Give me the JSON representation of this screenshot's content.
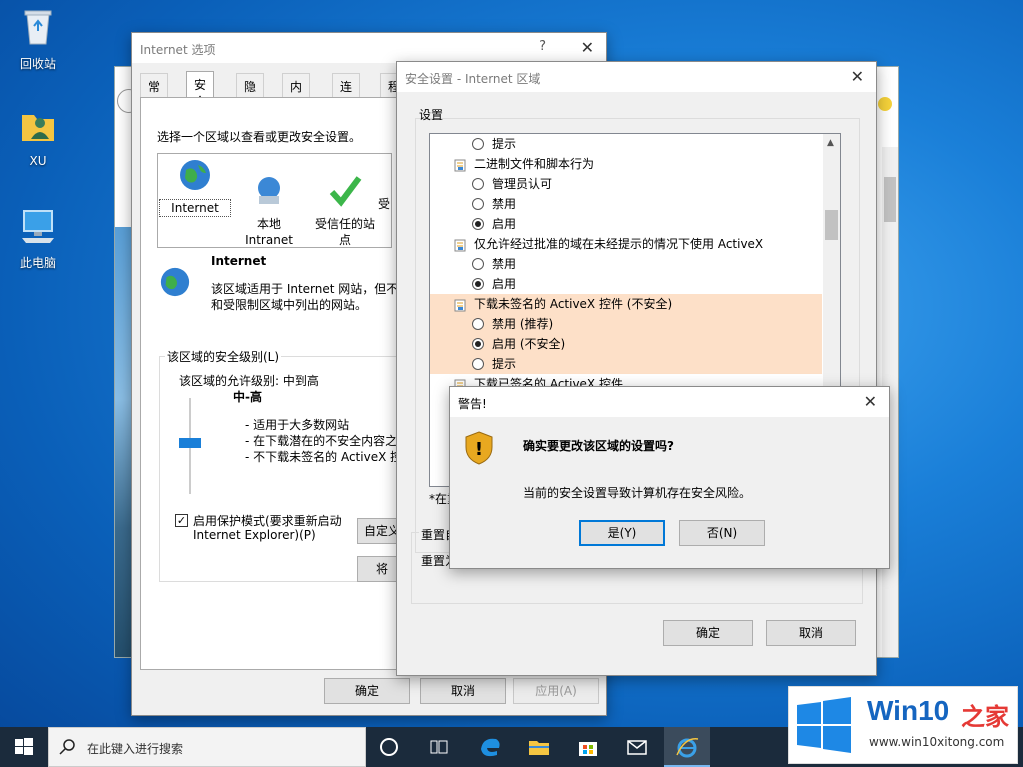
{
  "desktop": {
    "icons": [
      {
        "label": "回收站"
      },
      {
        "label": "XU"
      },
      {
        "label": "此电脑"
      }
    ]
  },
  "inet_options": {
    "title": "Internet 选项",
    "help": "?",
    "close": "✕",
    "tabs": [
      "常规",
      "安全",
      "隐私",
      "内容",
      "连接",
      "程"
    ],
    "instruction": "选择一个区域以查看或更改安全设置。",
    "zones": [
      {
        "label": "Internet"
      },
      {
        "label": "本地\nIntranet"
      },
      {
        "label": "受信任的站\n点"
      },
      {
        "label": "受"
      }
    ],
    "zone_title": "Internet",
    "zone_desc_1": "该区域适用于 Internet 网站，但不",
    "zone_desc_2": "和受限制区域中列出的网站。",
    "level_group": "该区域的安全级别(L)",
    "allowed_level": "该区域的允许级别: 中到高",
    "level_name": "中-高",
    "level_bullets": [
      "- 适用于大多数网站",
      "- 在下载潜在的不安全内容之",
      "- 不下载未签名的 ActiveX 控"
    ],
    "protected_mode_1": "启用保护模式(要求重新启动",
    "protected_mode_2": "Internet Explorer)(P)",
    "custom_btn": "自定义",
    "default_btn": "将",
    "ok": "确定",
    "cancel": "取消",
    "apply": "应用(A)"
  },
  "security_settings": {
    "title": "安全设置 - Internet 区域",
    "close": "✕",
    "group_label": "设置",
    "rows": [
      {
        "kind": "radio",
        "text": "提示",
        "checked": false,
        "hl": false
      },
      {
        "kind": "folder",
        "text": "二进制文件和脚本行为",
        "hl": false
      },
      {
        "kind": "radio",
        "text": "管理员认可",
        "checked": false,
        "hl": false
      },
      {
        "kind": "radio",
        "text": "禁用",
        "checked": false,
        "hl": false
      },
      {
        "kind": "radio",
        "text": "启用",
        "checked": true,
        "hl": false
      },
      {
        "kind": "folder",
        "text": "仅允许经过批准的域在未经提示的情况下使用 ActiveX",
        "hl": false
      },
      {
        "kind": "radio",
        "text": "禁用",
        "checked": false,
        "hl": false
      },
      {
        "kind": "radio",
        "text": "启用",
        "checked": true,
        "hl": false
      },
      {
        "kind": "folder",
        "text": "下载未签名的 ActiveX 控件 (不安全)",
        "hl": true
      },
      {
        "kind": "radio",
        "text": "禁用 (推荐)",
        "checked": false,
        "hl": true
      },
      {
        "kind": "radio",
        "text": "启用 (不安全)",
        "checked": true,
        "hl": true
      },
      {
        "kind": "radio",
        "text": "提示",
        "checked": false,
        "hl": true
      },
      {
        "kind": "folder",
        "text": "下载已签名的 ActiveX 控件",
        "hl": false
      }
    ],
    "restart_note": "*在重",
    "reset_group": "重置自",
    "reset_label": "重置为",
    "ok": "确定",
    "cancel": "取消"
  },
  "warning": {
    "title": "警告!",
    "close": "✕",
    "question": "确实要更改该区域的设置吗?",
    "detail": "当前的安全设置导致计算机存在安全风险。",
    "yes": "是(Y)",
    "no": "否(N)"
  },
  "taskbar": {
    "search_placeholder": "在此键入进行搜索"
  },
  "watermark": {
    "brand": "Win10",
    "brand_cn": "之家",
    "url": "www.win10xitong.com"
  }
}
